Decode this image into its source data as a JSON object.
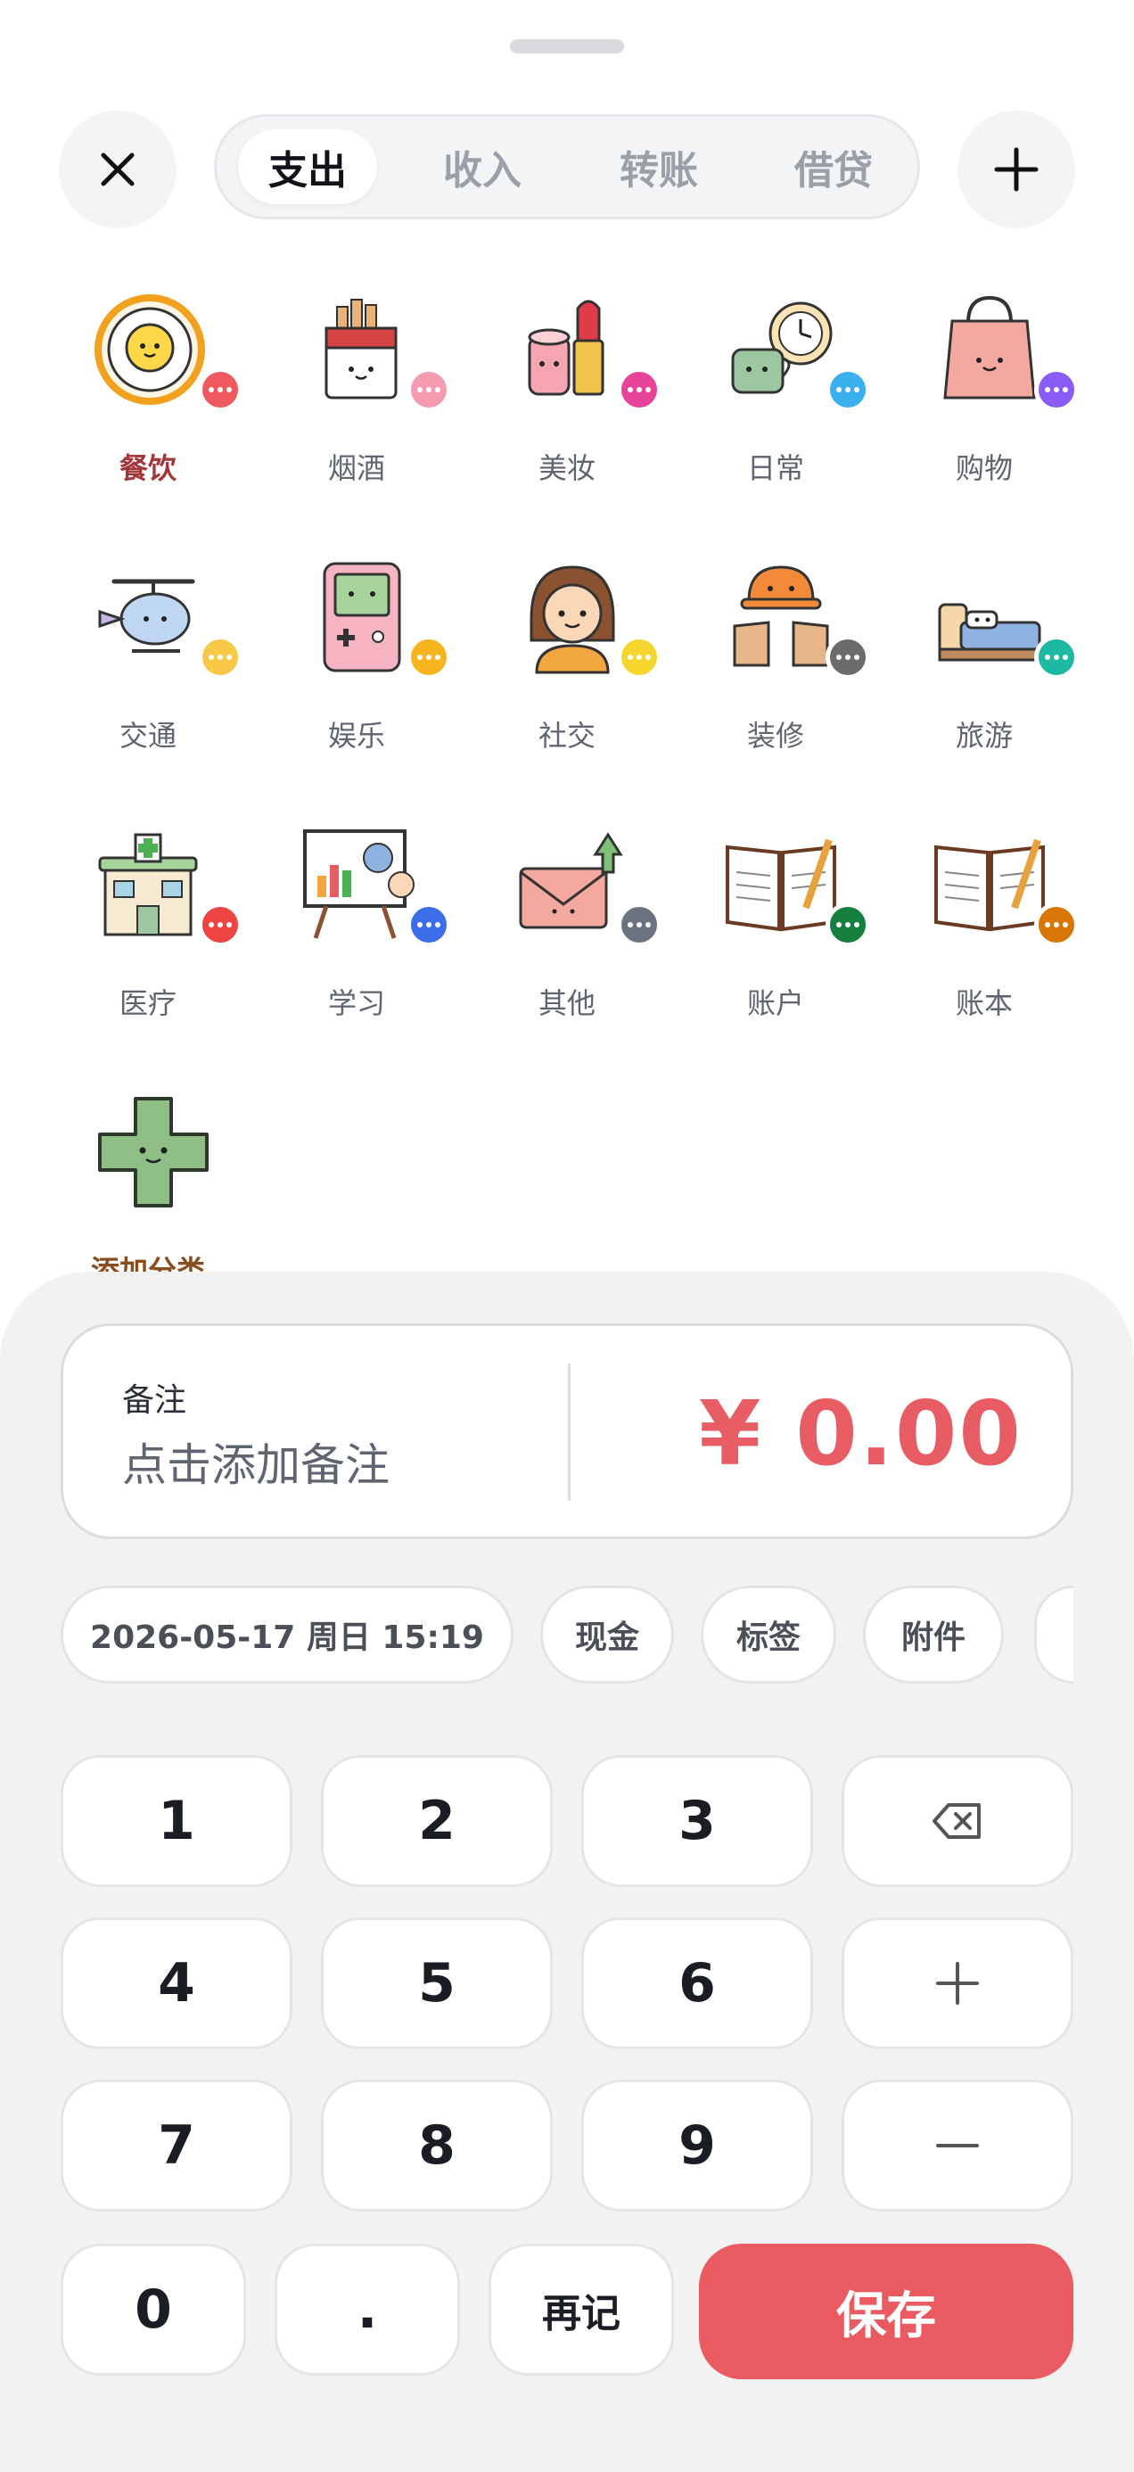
{
  "header": {
    "close_icon": "close-icon",
    "add_icon": "plus-icon",
    "tabs": [
      {
        "label": "支出",
        "active": true
      },
      {
        "label": "收入",
        "active": false
      },
      {
        "label": "转账",
        "active": false
      },
      {
        "label": "借贷",
        "active": false
      }
    ]
  },
  "categories": [
    {
      "label": "餐饮",
      "icon": "fried-egg-icon",
      "badge_color": "#ef5a5f",
      "selected": true
    },
    {
      "label": "烟酒",
      "icon": "cigarette-pack-icon",
      "badge_color": "#f49bb0",
      "selected": false
    },
    {
      "label": "美妆",
      "icon": "lipstick-icon",
      "badge_color": "#e8439a",
      "selected": false
    },
    {
      "label": "日常",
      "icon": "coffee-clock-icon",
      "badge_color": "#3ab0ef",
      "selected": false
    },
    {
      "label": "购物",
      "icon": "shopping-bag-icon",
      "badge_color": "#8b5cf6",
      "selected": false
    },
    {
      "label": "交通",
      "icon": "helicopter-icon",
      "badge_color": "#f8c847",
      "selected": false
    },
    {
      "label": "娱乐",
      "icon": "game-console-icon",
      "badge_color": "#f6b51f",
      "selected": false
    },
    {
      "label": "社交",
      "icon": "person-icon",
      "badge_color": "#f6d52e",
      "selected": false
    },
    {
      "label": "装修",
      "icon": "helmet-gloves-icon",
      "badge_color": "#6b6b6b",
      "selected": false
    },
    {
      "label": "旅游",
      "icon": "hotel-bed-icon",
      "badge_color": "#1fb8a3",
      "selected": false
    },
    {
      "label": "医疗",
      "icon": "hospital-icon",
      "badge_color": "#ef4444",
      "selected": false
    },
    {
      "label": "学习",
      "icon": "presentation-board-icon",
      "badge_color": "#3b6ee8",
      "selected": false
    },
    {
      "label": "其他",
      "icon": "envelope-icon",
      "badge_color": "#6b7280",
      "selected": false
    },
    {
      "label": "账户",
      "icon": "open-ledger-icon",
      "badge_color": "#15803d",
      "selected": false
    },
    {
      "label": "账本",
      "icon": "open-ledger-icon",
      "badge_color": "#d97706",
      "selected": false
    },
    {
      "label": "添加分类",
      "icon": "plus-cross-icon",
      "badge_color": "",
      "selected": false
    }
  ],
  "note": {
    "label": "备注",
    "placeholder": "点击添加备注"
  },
  "amount": "¥ 0.00",
  "chips": [
    "2026-05-17 周日 15:19",
    "现金",
    "标签",
    "附件"
  ],
  "keypad": {
    "rows": [
      [
        "1",
        "2",
        "3",
        "backspace"
      ],
      [
        "4",
        "5",
        "6",
        "plus"
      ],
      [
        "7",
        "8",
        "9",
        "minus"
      ]
    ],
    "bottom": [
      "0",
      ".",
      "再记"
    ],
    "save_label": "保存"
  },
  "colors": {
    "accent": "#ea5a61",
    "selected_label": "#a2373a",
    "panel_bg": "#f2f2f3"
  }
}
